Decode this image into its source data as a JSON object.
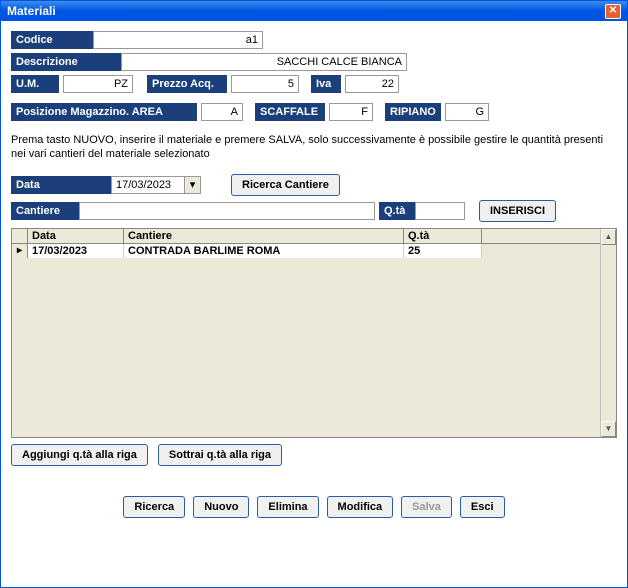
{
  "window": {
    "title": "Materiali"
  },
  "fields": {
    "codice": {
      "label": "Codice",
      "value": "a1"
    },
    "descrizione": {
      "label": "Descrizione",
      "value": "SACCHI CALCE BIANCA"
    },
    "um": {
      "label": "U.M.",
      "value": "PZ"
    },
    "prezzo": {
      "label": "Prezzo Acq.",
      "value": "5"
    },
    "iva": {
      "label": "Iva",
      "value": "22"
    },
    "posizione": {
      "label": "Posizione Magazzino. AREA",
      "value": "A"
    },
    "scaffale": {
      "label": "SCAFFALE",
      "value": "F"
    },
    "ripiano": {
      "label": "RIPIANO",
      "value": "G"
    },
    "data": {
      "label": "Data",
      "value": "17/03/2023"
    },
    "cantiere": {
      "label": "Cantiere",
      "value": ""
    },
    "qta": {
      "label": "Q.tà",
      "value": ""
    }
  },
  "instruction": "Prema tasto NUOVO, inserire il materiale e premere SALVA, solo successivamente è possibile gestire le quantità presenti nei vari cantieri del materiale selezionato",
  "buttons": {
    "ricerca_cantiere": "Ricerca Cantiere",
    "inserisci": "INSERISCI",
    "aggiungi": "Aggiungi q.tà alla riga",
    "sottrai": "Sottrai q.tà alla riga",
    "ricerca": "Ricerca",
    "nuovo": "Nuovo",
    "elimina": "Elimina",
    "modifica": "Modifica",
    "salva": "Salva",
    "esci": "Esci"
  },
  "grid": {
    "headers": {
      "data": "Data",
      "cantiere": "Cantiere",
      "qta": "Q.tà"
    },
    "rows": [
      {
        "data": "17/03/2023",
        "cantiere": "CONTRADA BARLIME ROMA",
        "qta": "25"
      }
    ]
  }
}
